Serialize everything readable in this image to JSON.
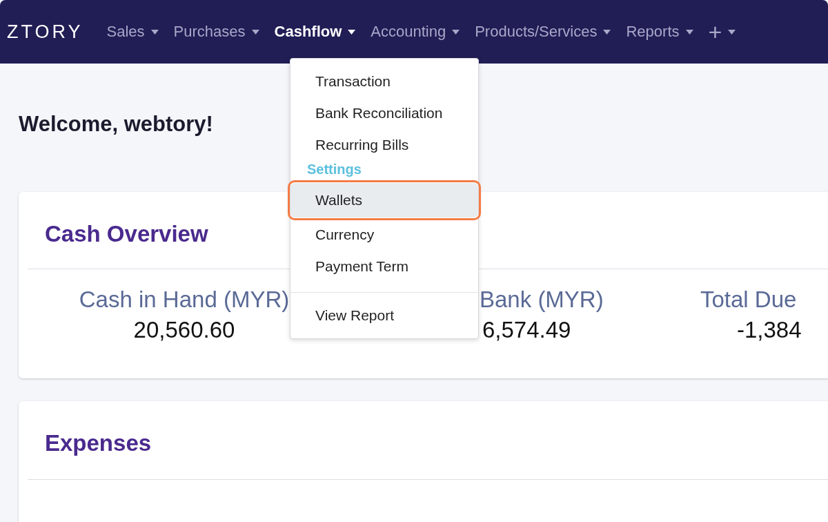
{
  "navbar": {
    "logo": "ZTORY",
    "items": [
      {
        "label": "Sales",
        "selected": false
      },
      {
        "label": "Purchases",
        "selected": false
      },
      {
        "label": "Cashflow",
        "selected": true
      },
      {
        "label": "Accounting",
        "selected": false
      },
      {
        "label": "Products/Services",
        "selected": false
      },
      {
        "label": "Reports",
        "selected": false
      },
      {
        "label": "+",
        "selected": false
      }
    ]
  },
  "welcome": "Welcome, webtory!",
  "cash_overview": {
    "title": "Cash Overview",
    "stats": [
      {
        "label": "Cash in Hand (MYR)",
        "value": "20,560.60"
      },
      {
        "label": "Bank (MYR)",
        "value": "6,574.49"
      },
      {
        "label": "Total Due",
        "value": "-1,384"
      }
    ]
  },
  "expenses": {
    "title": "Expenses"
  },
  "dropdown": {
    "items": [
      {
        "kind": "item",
        "label": "Transaction",
        "highlighted": false
      },
      {
        "kind": "item",
        "label": "Bank Reconciliation",
        "highlighted": false
      },
      {
        "kind": "item",
        "label": "Recurring Bills",
        "highlighted": false
      },
      {
        "kind": "header",
        "label": "Settings"
      },
      {
        "kind": "item",
        "label": "Wallets",
        "highlighted": true
      },
      {
        "kind": "item",
        "label": "Currency",
        "highlighted": false
      },
      {
        "kind": "item",
        "label": "Payment Term",
        "highlighted": false
      },
      {
        "kind": "divider"
      },
      {
        "kind": "item",
        "label": "View Report",
        "highlighted": false
      }
    ]
  }
}
